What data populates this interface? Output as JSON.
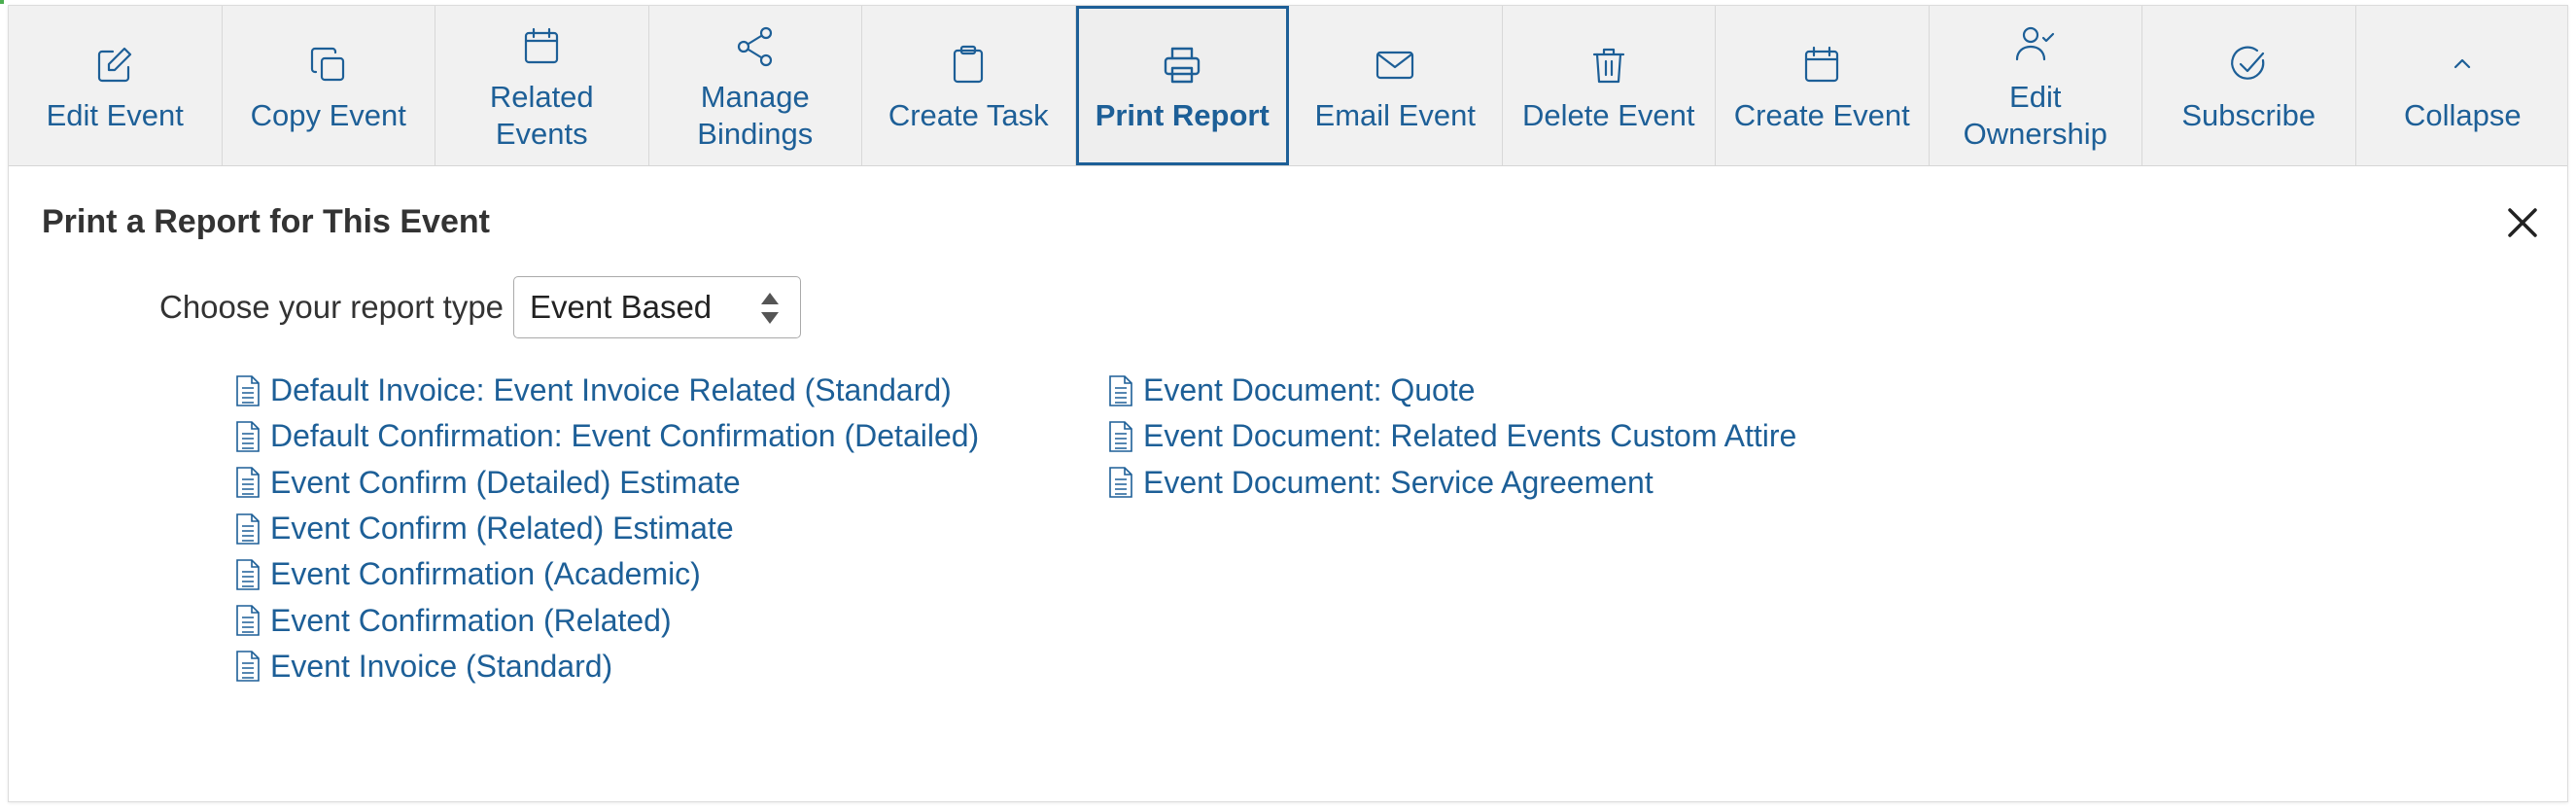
{
  "colors": {
    "accent": "#1d5f97",
    "toolbar_bg": "#f1f1f1",
    "title_text": "#333333"
  },
  "toolbar": {
    "buttons": [
      {
        "label": "Edit Event",
        "icon": "edit-icon"
      },
      {
        "label": "Copy Event",
        "icon": "copy-icon"
      },
      {
        "label": "Related\nEvents",
        "icon": "calendar-icon"
      },
      {
        "label": "Manage\nBindings",
        "icon": "share-icon"
      },
      {
        "label": "Create Task",
        "icon": "clipboard-icon"
      },
      {
        "label": "Print Report",
        "icon": "printer-icon",
        "active": true
      },
      {
        "label": "Email Event",
        "icon": "envelope-icon"
      },
      {
        "label": "Delete Event",
        "icon": "trash-icon"
      },
      {
        "label": "Create Event",
        "icon": "calendar-icon"
      },
      {
        "label": "Edit\nOwnership",
        "icon": "user-check-icon"
      },
      {
        "label": "Subscribe",
        "icon": "check-circle-icon"
      },
      {
        "label": "Collapse",
        "icon": "chevron-up-icon"
      }
    ]
  },
  "panel": {
    "title": "Print a Report for This Event",
    "close_icon": "close-icon"
  },
  "report_type": {
    "label": "Choose your report type",
    "selected": "Event Based"
  },
  "reports": {
    "column1": [
      "Default Invoice: Event Invoice Related (Standard)",
      "Default Confirmation: Event Confirmation (Detailed)",
      "Event Confirm (Detailed) Estimate",
      "Event Confirm (Related) Estimate",
      "Event Confirmation (Academic)",
      "Event Confirmation (Related)",
      "Event Invoice (Standard)"
    ],
    "column2": [
      "Event Document: Quote",
      "Event Document: Related Events Custom Attire",
      "Event Document: Service Agreement"
    ],
    "item_icon": "document-icon"
  }
}
